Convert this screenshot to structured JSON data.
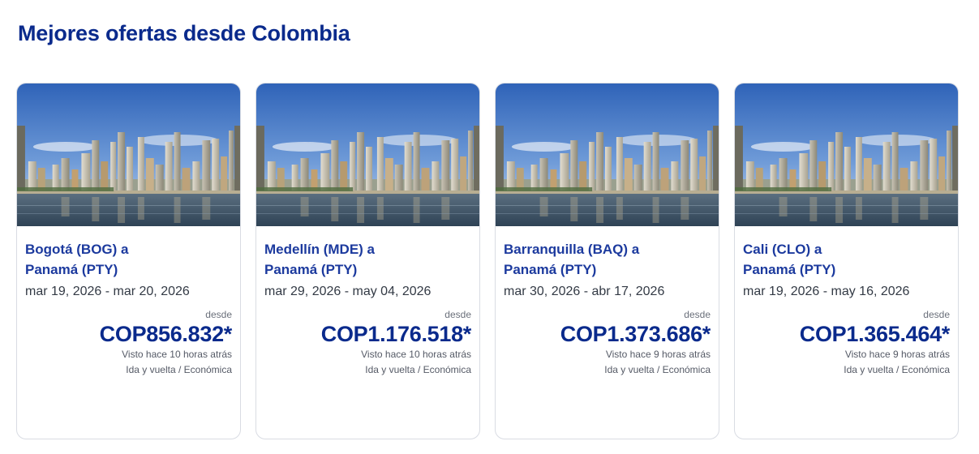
{
  "section": {
    "title": "Mejores ofertas desde Colombia"
  },
  "colors": {
    "title": "#0a2a8c",
    "route": "#1c3a9e",
    "price": "#0a2a8c",
    "card_border": "#d9dce3"
  },
  "offers": [
    {
      "origin": "Bogotá (BOG) a",
      "destination": "Panamá (PTY)",
      "dates": "mar 19, 2026 - mar 20, 2026",
      "from_label": "desde",
      "price": "COP856.832*",
      "seen": "Visto hace 10 horas atrás",
      "trip": "Ida y vuelta / Económica",
      "image": "panama-city-skyline"
    },
    {
      "origin": "Medellín (MDE) a",
      "destination": "Panamá (PTY)",
      "dates": "mar 29, 2026 - may 04, 2026",
      "from_label": "desde",
      "price": "COP1.176.518*",
      "seen": "Visto hace 10 horas atrás",
      "trip": "Ida y vuelta / Económica",
      "image": "panama-city-skyline"
    },
    {
      "origin": "Barranquilla (BAQ) a",
      "destination": "Panamá (PTY)",
      "dates": "mar 30, 2026 - abr 17, 2026",
      "from_label": "desde",
      "price": "COP1.373.686*",
      "seen": "Visto hace 9 horas atrás",
      "trip": "Ida y vuelta / Económica",
      "image": "panama-city-skyline"
    },
    {
      "origin": "Cali (CLO) a",
      "destination": "Panamá (PTY)",
      "dates": "mar 19, 2026 - may 16, 2026",
      "from_label": "desde",
      "price": "COP1.365.464*",
      "seen": "Visto hace 9 horas atrás",
      "trip": "Ida y vuelta / Económica",
      "image": "panama-city-skyline"
    }
  ]
}
